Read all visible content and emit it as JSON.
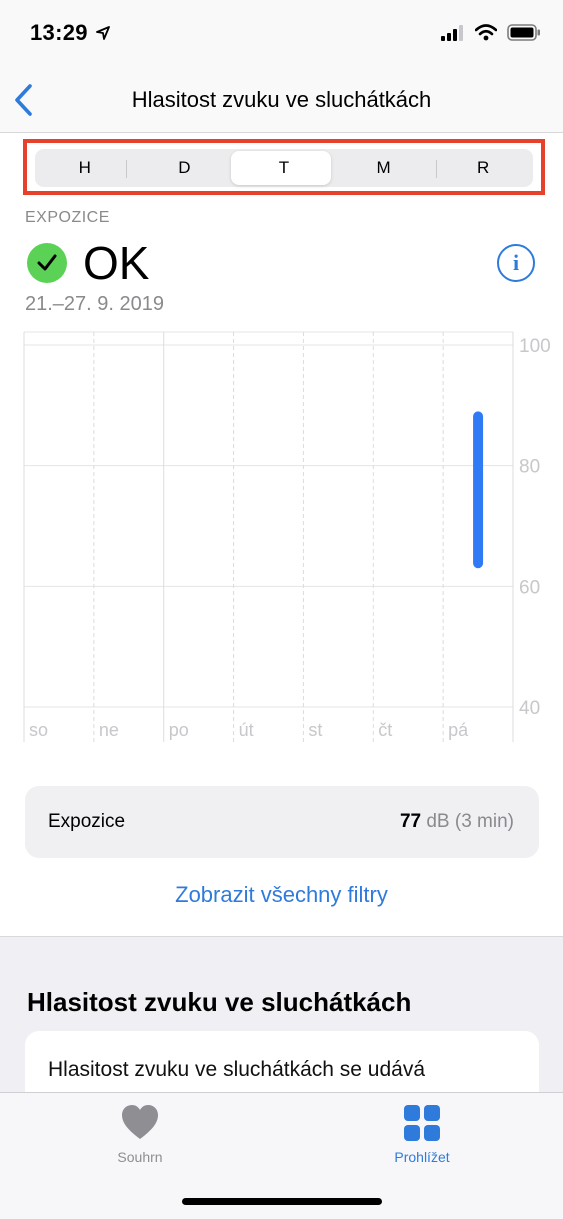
{
  "status": {
    "time": "13:29"
  },
  "nav": {
    "title": "Hlasitost zvuku ve sluchátkách"
  },
  "segments": [
    {
      "label": "H",
      "active": false
    },
    {
      "label": "D",
      "active": false
    },
    {
      "label": "T",
      "active": true
    },
    {
      "label": "M",
      "active": false
    },
    {
      "label": "R",
      "active": false
    }
  ],
  "summary": {
    "section_label": "EXPOZICE",
    "status_text": "OK",
    "date_range": "21.–27. 9. 2019"
  },
  "chart_data": {
    "type": "bar",
    "categories": [
      "so",
      "ne",
      "po",
      "út",
      "st",
      "čt",
      "pá"
    ],
    "y_ticks": [
      "100",
      "80",
      "60",
      "40"
    ],
    "ylim": [
      40,
      100
    ],
    "ranges": [
      {
        "category": "pá",
        "min": 63,
        "max": 89
      }
    ],
    "color": "#2f7bf5"
  },
  "exposure": {
    "label": "Expozice",
    "value": "77",
    "unit": "dB (3 min)"
  },
  "filters_link": "Zobrazit všechny filtry",
  "info_section": {
    "title": "Hlasitost zvuku ve sluchátkách",
    "text": "Hlasitost zvuku ve sluchátkách se udává"
  },
  "tabbar": {
    "summary": "Souhrn",
    "browse": "Prohlížet"
  },
  "colors": {
    "accent": "#2f7bdc",
    "ok_green": "#5bd156",
    "highlight": "#e8412b"
  }
}
